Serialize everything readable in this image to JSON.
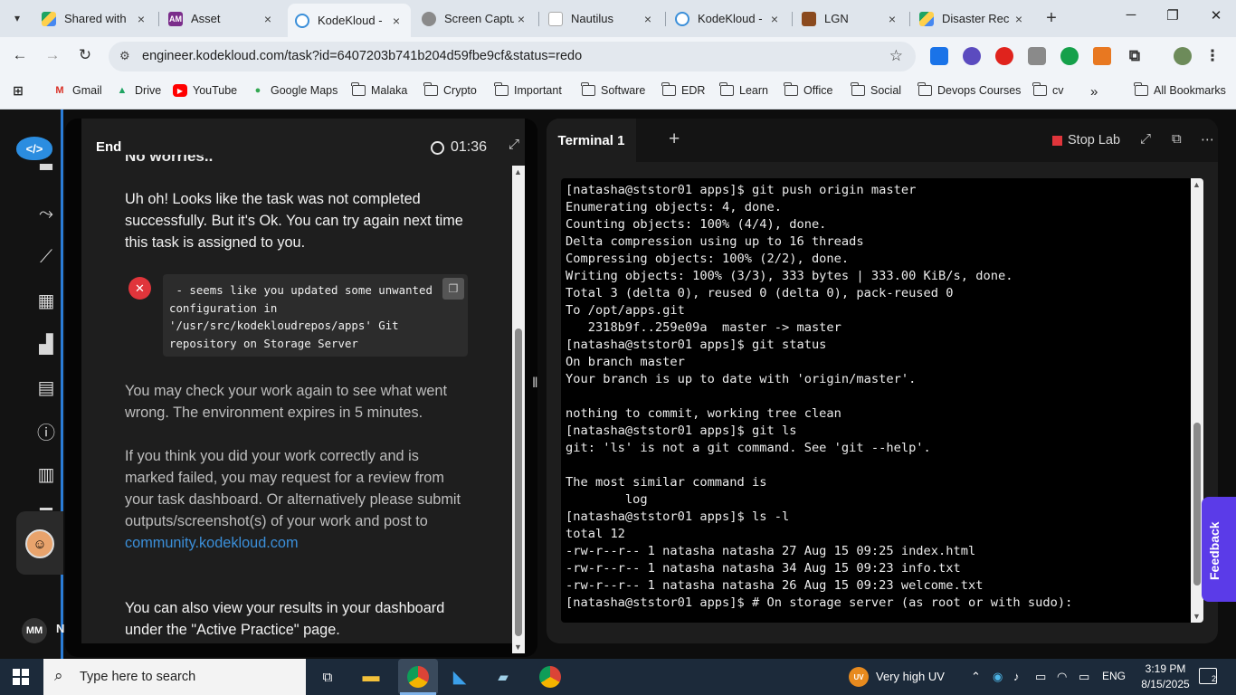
{
  "browser": {
    "tabs": [
      {
        "label": "Shared with",
        "close": "×",
        "icon": "google-drive-icon"
      },
      {
        "label": "Asset",
        "close": "×",
        "icon": "asset-icon",
        "fav_text": "AM"
      },
      {
        "label": "KodeKloud -",
        "close": "×",
        "icon": "kodekloud-icon",
        "active": true
      },
      {
        "label": "Screen Captu",
        "close": "×",
        "icon": "camera-icon"
      },
      {
        "label": "Nautilus",
        "close": "×",
        "icon": "document-icon"
      },
      {
        "label": "KodeKloud -",
        "close": "×",
        "icon": "kodekloud-icon"
      },
      {
        "label": "LGN",
        "close": "×",
        "icon": "lgn-icon"
      },
      {
        "label": "Disaster Rec",
        "close": "×",
        "icon": "google-drive-icon"
      }
    ],
    "new_tab": "+",
    "url": "engineer.kodekloud.com/task?id=6407203b741b204d59fbe9cf&status=redo",
    "bookmarks": [
      {
        "label": "Gmail",
        "icon": "gmail-icon"
      },
      {
        "label": "Drive",
        "icon": "drive-icon"
      },
      {
        "label": "YouTube",
        "icon": "youtube-icon"
      },
      {
        "label": "Google Maps",
        "icon": "maps-icon"
      },
      {
        "label": "Malaka",
        "icon": "folder-icon"
      },
      {
        "label": "Crypto",
        "icon": "folder-icon"
      },
      {
        "label": "Important",
        "icon": "folder-icon"
      },
      {
        "label": "Software",
        "icon": "folder-icon"
      },
      {
        "label": "EDR",
        "icon": "folder-icon"
      },
      {
        "label": "Learn",
        "icon": "folder-icon"
      },
      {
        "label": "Office",
        "icon": "folder-icon"
      },
      {
        "label": "Social",
        "icon": "folder-icon"
      },
      {
        "label": "Devops Courses",
        "icon": "folder-icon"
      },
      {
        "label": "cv",
        "icon": "folder-icon"
      }
    ],
    "more_bookmarks": "»",
    "all_bookmarks": "All Bookmarks"
  },
  "sidebar": {
    "user_initials": "MM",
    "user_name_cut": "N"
  },
  "task": {
    "tab_label": "End",
    "timer": "01:36",
    "heading_cut": "No worries..",
    "message_1": "Uh oh! Looks like the task was not completed successfully. But it's Ok. You can try again next time this task is assigned to you.",
    "error_text": " - seems like you updated some unwanted configuration in '/usr/src/kodekloudrepos/apps' Git repository on Storage Server",
    "message_2": "You may check your work again to see what went wrong. The environment expires in 5 minutes.",
    "message_3": "If you think you did your work correctly and is marked failed, you may request for a review from your task dashboard. Or alternatively please submit outputs/screenshot(s) of your work and post to",
    "community_link": "community.kodekloud.com",
    "message_4": "You can also view your results in your dashboard under the \"Active Practice\" page."
  },
  "terminal": {
    "tab_label": "Terminal 1",
    "add_tab": "+",
    "stop_label": "Stop Lab",
    "lines": [
      "[natasha@ststor01 apps]$ git push origin master",
      "Enumerating objects: 4, done.",
      "Counting objects: 100% (4/4), done.",
      "Delta compression using up to 16 threads",
      "Compressing objects: 100% (2/2), done.",
      "Writing objects: 100% (3/3), 333 bytes | 333.00 KiB/s, done.",
      "Total 3 (delta 0), reused 0 (delta 0), pack-reused 0",
      "To /opt/apps.git",
      "   2318b9f..259e09a  master -> master",
      "[natasha@ststor01 apps]$ git status",
      "On branch master",
      "Your branch is up to date with 'origin/master'.",
      "",
      "nothing to commit, working tree clean",
      "[natasha@ststor01 apps]$ git ls",
      "git: 'ls' is not a git command. See 'git --help'.",
      "",
      "The most similar command is",
      "        log",
      "[natasha@ststor01 apps]$ ls -l",
      "total 12",
      "-rw-r--r-- 1 natasha natasha 27 Aug 15 09:25 index.html",
      "-rw-r--r-- 1 natasha natasha 34 Aug 15 09:23 info.txt",
      "-rw-r--r-- 1 natasha natasha 26 Aug 15 09:23 welcome.txt",
      "[natasha@ststor01 apps]$ # On storage server (as root or with sudo):"
    ]
  },
  "feedback_label": "Feedback",
  "taskbar": {
    "search_placeholder": "Type here to search",
    "uv_badge": "UV",
    "weather": "Very high UV",
    "language": "ENG",
    "time": "3:19 PM",
    "date": "8/15/2025",
    "notification_count": "2"
  }
}
